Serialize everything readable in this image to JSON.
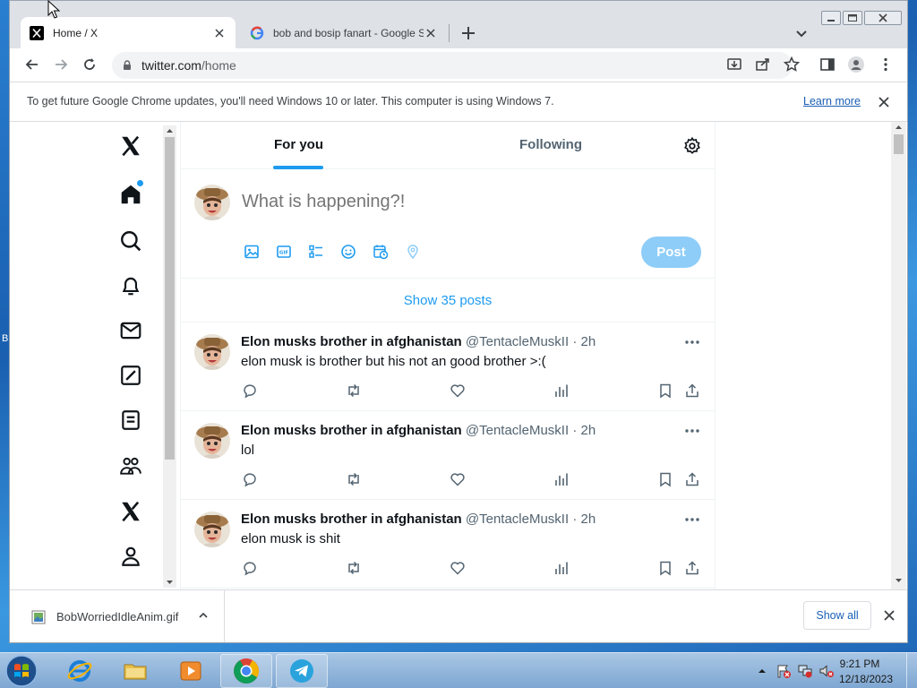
{
  "browser": {
    "tabs": [
      {
        "title": "Home / X"
      },
      {
        "title": "bob and bosip fanart - Google Se"
      }
    ],
    "url_host": "twitter.com",
    "url_path": "/home"
  },
  "infobar": {
    "message": "To get future Google Chrome updates, you'll need Windows 10 or later. This computer is using Windows 7.",
    "link": "Learn more"
  },
  "x": {
    "nav_icons": [
      "x-logo-icon",
      "home-icon",
      "explore-icon",
      "notifications-icon",
      "messages-icon",
      "grok-icon",
      "lists-icon",
      "communities-icon",
      "premium-icon",
      "profile-icon"
    ],
    "feed_tabs": {
      "for_you": "For you",
      "following": "Following"
    },
    "composer": {
      "placeholder": "What is happening?!",
      "post_label": "Post"
    },
    "show_posts": "Show 35 posts",
    "posts": [
      {
        "name": "Elon musks brother in afghanistan",
        "handle": "@TentacleMuskII",
        "time": "2h",
        "text": "elon musk is brother but his not an good brother >:("
      },
      {
        "name": "Elon musks brother in afghanistan",
        "handle": "@TentacleMuskII",
        "time": "2h",
        "text": "lol"
      },
      {
        "name": "Elon musks brother in afghanistan",
        "handle": "@TentacleMuskII",
        "time": "2h",
        "text": "elon musk is shit"
      }
    ],
    "accent_color": "#1d9bf0"
  },
  "downloads": {
    "file": "BobWorriedIdleAnim.gif",
    "show_all": "Show all"
  },
  "taskbar": {
    "time": "9:21 PM",
    "date": "12/18/2023"
  },
  "desktop": {
    "label": "B"
  }
}
